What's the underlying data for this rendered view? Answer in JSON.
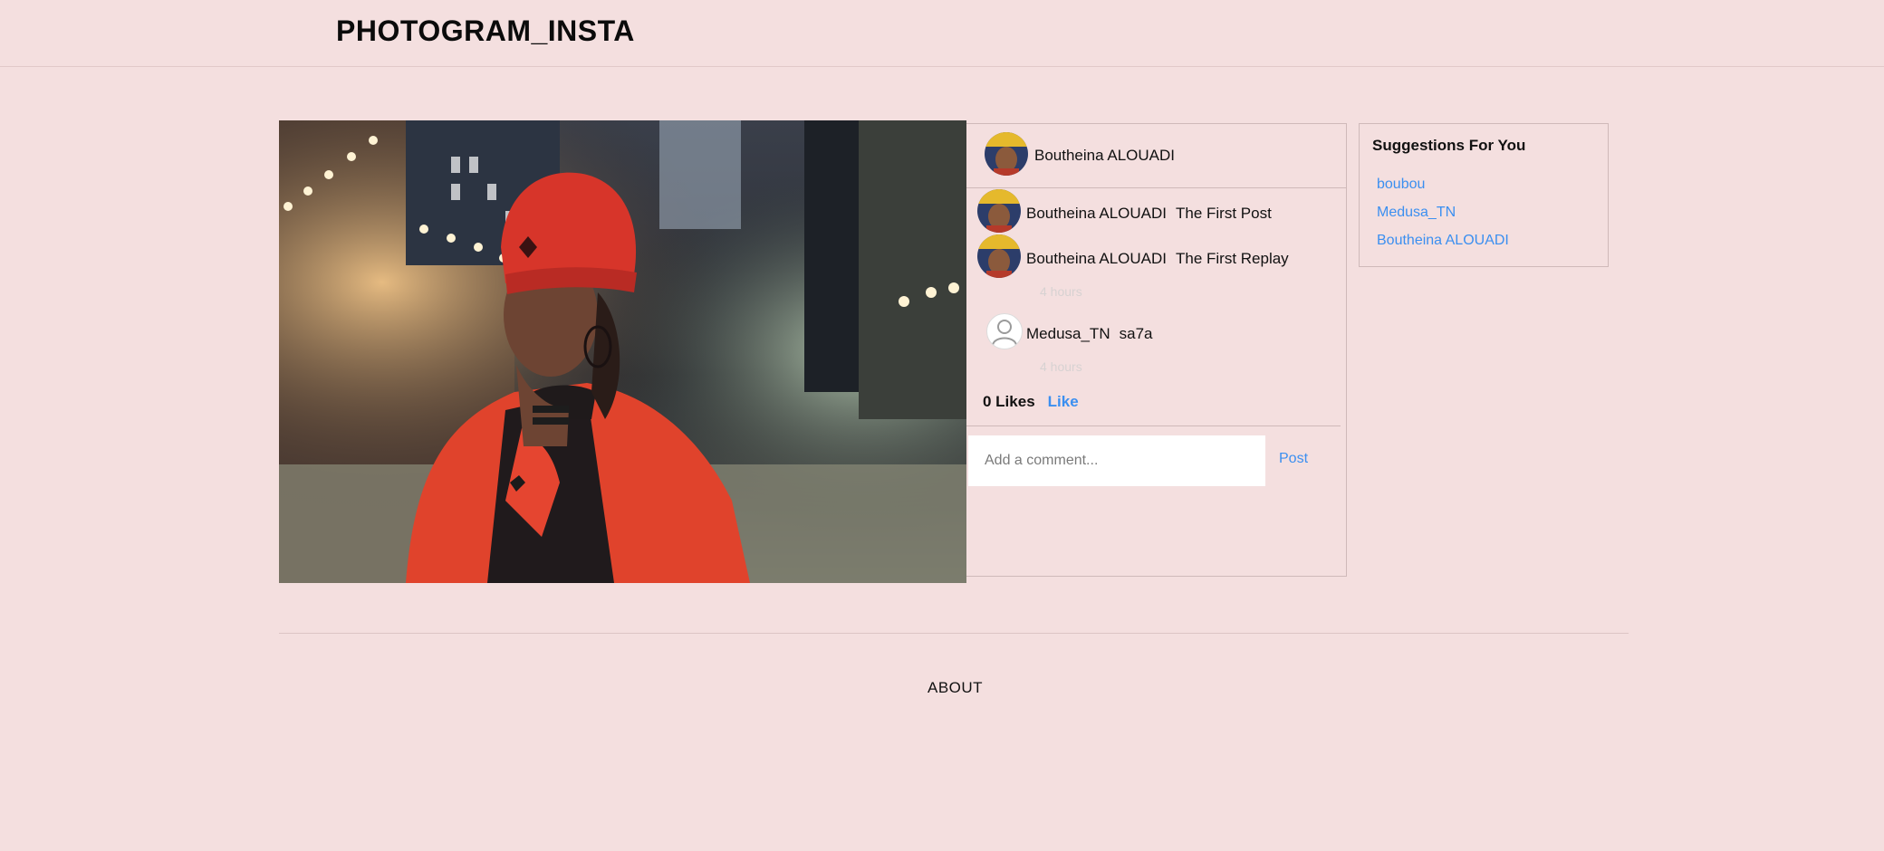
{
  "app": {
    "brand": "PHOTOGRAM_INSTA"
  },
  "post": {
    "author": "Boutheina ALOUADI",
    "comments": [
      {
        "user": "Boutheina ALOUADI",
        "text": "The First Post",
        "time": ""
      },
      {
        "user": "Boutheina ALOUADI",
        "text": "The First Replay",
        "time": "4 hours"
      },
      {
        "user": "Medusa_TN",
        "text": "sa7a",
        "time": "4 hours"
      }
    ],
    "likes_label": "0 Likes",
    "like_link": "Like",
    "comment_placeholder": "Add a comment...",
    "post_label": "Post"
  },
  "suggestions": {
    "title": "Suggestions For You",
    "users": [
      "boubou",
      "Medusa_TN",
      "Boutheina ALOUADI"
    ]
  },
  "footer": {
    "about": "ABOUT"
  },
  "colors": {
    "background": "#f4dfdf",
    "link": "#3b8ff0",
    "border": "#cfb9b9"
  }
}
